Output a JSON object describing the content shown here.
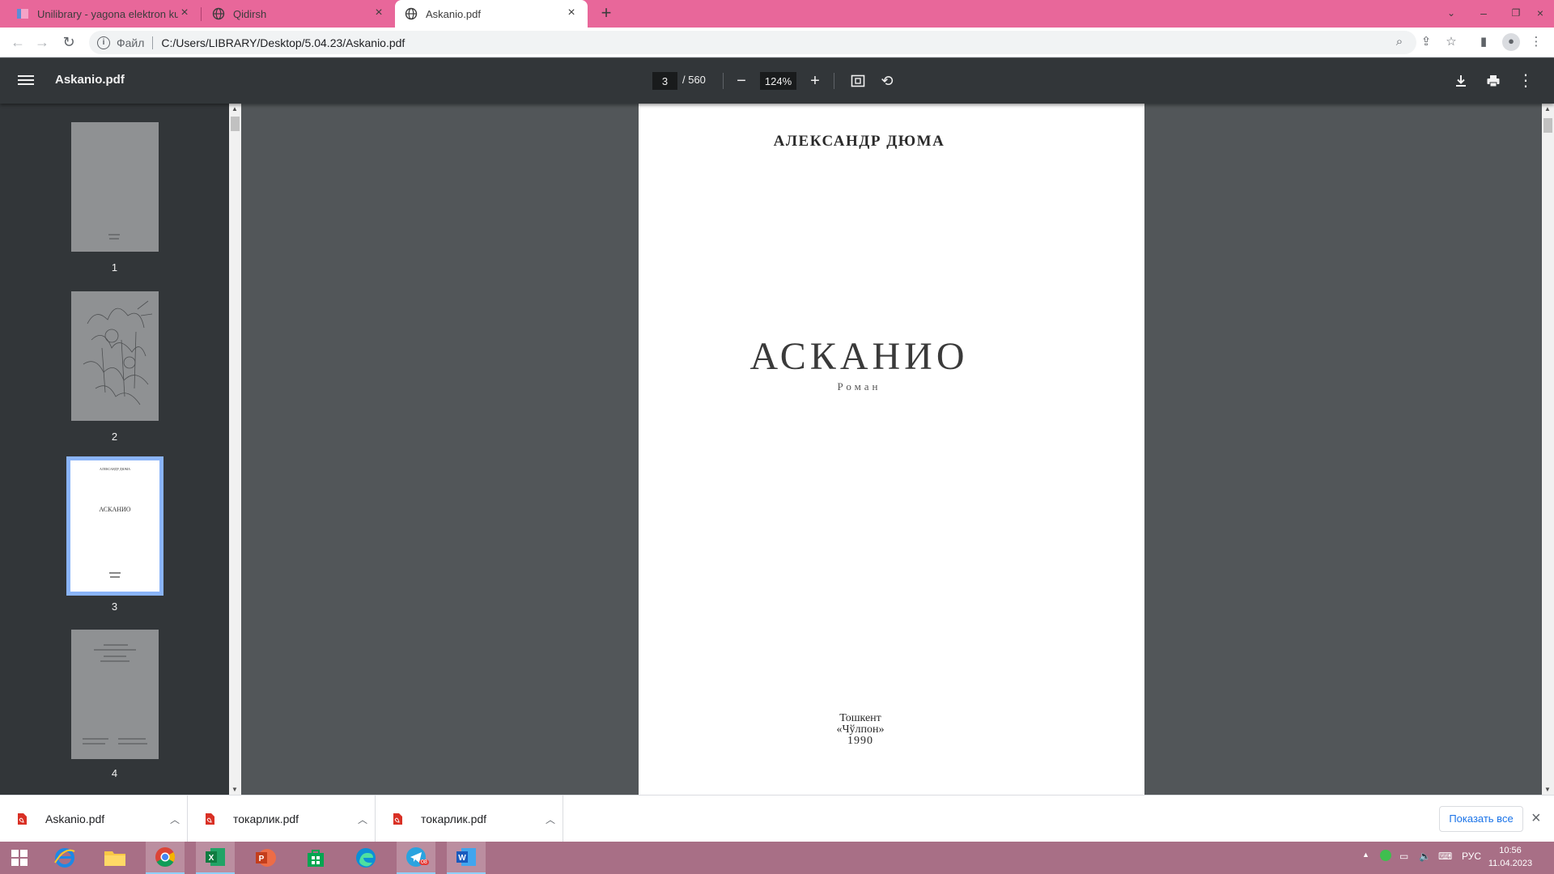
{
  "browser": {
    "tabs": [
      {
        "title": "Unilibrary - yagona elektron kutubxona",
        "active": false
      },
      {
        "title": "Qidirsh",
        "active": false
      },
      {
        "title": "Askanio.pdf",
        "active": true
      }
    ],
    "new_tab_icon": "plus-icon",
    "address": {
      "scheme_label": "Файл",
      "url": "C:/Users/LIBRARY/Desktop/5.04.23/Askanio.pdf"
    }
  },
  "pdf_viewer": {
    "title": "Askanio.pdf",
    "current_page": "3",
    "total_pages": "/ 560",
    "zoom": "124%",
    "thumbnails": [
      {
        "number": "1"
      },
      {
        "number": "2"
      },
      {
        "number": "3",
        "selected": true
      },
      {
        "number": "4"
      }
    ],
    "thumb3_text": {
      "author": "АЛЕКСАНДР ДЮМА",
      "title": "АСКАНИО"
    },
    "page": {
      "author": "АЛЕКСАНДР ДЮМА",
      "title": "АСКАНИО",
      "subtitle": "Роман",
      "city": "Тошкент",
      "publisher": "«Чўлпон»",
      "year": "1990"
    }
  },
  "downloads": {
    "items": [
      {
        "name": "Askanio.pdf"
      },
      {
        "name": "токарлик.pdf"
      },
      {
        "name": "токарлик.pdf"
      }
    ],
    "show_all": "Показать все"
  },
  "taskbar": {
    "language": "РУС",
    "time": "10:56",
    "date": "11.04.2023",
    "telegram_badge": "08",
    "colors": {
      "accent": "#e8679a",
      "taskbar": "#a86f86",
      "pdf_toolbar": "#323639"
    }
  }
}
